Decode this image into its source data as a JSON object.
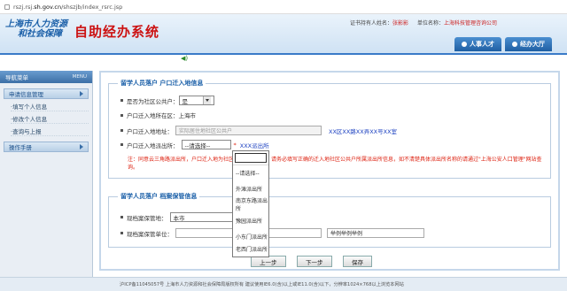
{
  "browser": {
    "url_prefix": "rszj.rsj.",
    "url_domain": "sh.gov.cn",
    "url_path": "/shszjb/index_rsrc.jsp"
  },
  "header": {
    "logo_line1": "上海市人力资源",
    "logo_line2": "和社会保障",
    "system_title": "自助经办系统",
    "holder_label": "证书持有人姓名：",
    "holder_name": "张影影",
    "unit_label": "单位名称：",
    "unit_name": "上海科技管理咨询公司",
    "nav": [
      "人事人才",
      "经办大厅"
    ]
  },
  "sidebar": {
    "title": "导航菜单",
    "menu_label": "MENU",
    "section1": "申请信息管理",
    "items": [
      "·填写个人信息",
      "·修改个人信息",
      "·查询与上报"
    ],
    "section2": "操作手册"
  },
  "form1": {
    "legend": "留学人员落户 户口迁入地信息",
    "is_community_label": "是否为社区公共户：",
    "is_community_value": "是",
    "district_label": "户口迁入地所在区：",
    "district_value": "上海市",
    "address_label": "户口迁入地地址：",
    "address_placeholder": "实际居住地社区公共户",
    "address_example": "XX区XX路XX弄XX号XX室",
    "police_label": "户口迁入地派出所：",
    "police_value": "--请选择--",
    "police_hint": "XXX派出所",
    "note": "注：同意云三角路派出所，户口迁入地为社区公共户的人员，请务必填写正确的迁入地社区公共户所属派出所信息，如不清楚具体派出所名称的请通过\"上海公安人口管理\"网站查询。"
  },
  "form2": {
    "legend": "留学人员落户 档案保管信息",
    "archive_place_label": "现档案保管地：",
    "archive_place_value": "本市",
    "archive_unit_label": "现档案保管单位：",
    "archive_unit_value": "",
    "archive_unit_example": "举例举例举例"
  },
  "dropdown": {
    "options": [
      "--请选择--",
      "外滩派出所",
      "南京东路派出所",
      "豫园派出所",
      "小东门派出所",
      "老西门派出所"
    ]
  },
  "buttons": {
    "prev": "上一步",
    "next": "下一步",
    "save": "保存"
  },
  "footer": {
    "text": "沪ICP备11045057号    上海市人力资源和社会保障局版权所有  建议使用IE6.0(含)以上或IE11.0(含)以下，分辨率1024×768以上浏览本网站"
  }
}
